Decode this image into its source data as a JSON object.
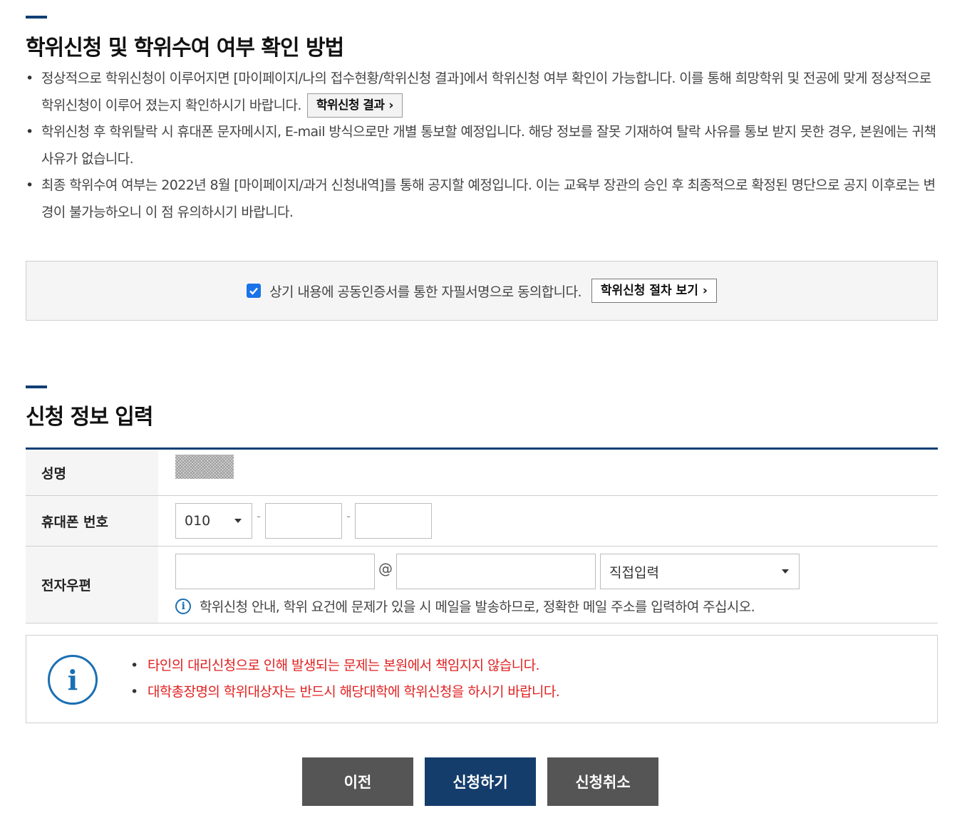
{
  "section1": {
    "title": "학위신청 및 학위수여 여부 확인 방법",
    "bullet1_text": "정상적으로 학위신청이 이루어지면 [마이페이지/나의 접수현황/학위신청 결과]에서 학위신청 여부 확인이 가능합니다. 이를 통해 희망학위 및 전공에 맞게 정상적으로 학위신청이 이루어 졌는지 확인하시기 바랍니다.",
    "result_button": "학위신청 결과",
    "bullet2_text": "학위신청 후 학위탈락 시 휴대폰 문자메시지, E-mail 방식으로만 개별 통보할 예정입니다. 해당 정보를 잘못 기재하여 탈락 사유를 통보 받지 못한 경우, 본원에는 귀책사유가 없습니다.",
    "bullet3_text": "최종 학위수여 여부는 2022년 8월 [마이페이지/과거 신청내역]를 통해 공지할 예정입니다. 이는 교육부 장관의 승인 후 최종적으로 확정된 명단으로 공지 이후로는 변경이 불가능하오니 이 점 유의하시기 바랍니다."
  },
  "agreement": {
    "checked": true,
    "text": "상기 내용에 공동인증서를 통한 자필서명으로 동의합니다.",
    "procedure_button": "학위신청 절차 보기"
  },
  "section2": {
    "title": "신청 정보 입력"
  },
  "form": {
    "name_label": "성명",
    "phone_label": "휴대폰 번호",
    "phone_prefix": "010",
    "phone_separator": "-",
    "email_label": "전자우편",
    "email_at": "@",
    "email_domain_select": "직접입력",
    "email_note": "학위신청 안내, 학위 요건에 문제가 있을 시 메일을 발송하므로, 정확한 메일 주소를 입력하여 주십시오."
  },
  "notice": {
    "items": [
      "타인의 대리신청으로 인해 발생되는 문제는 본원에서 책임지지 않습니다.",
      "대학총장명의 학위대상자는 반드시 해당대학에 학위신청을 하시기 바랍니다."
    ]
  },
  "buttons": {
    "prev": "이전",
    "submit": "신청하기",
    "cancel": "신청취소"
  },
  "colors": {
    "navy": "#143d6b",
    "gray_button": "#555555",
    "notice_red": "#e02020",
    "info_blue": "#1a6fb3"
  }
}
